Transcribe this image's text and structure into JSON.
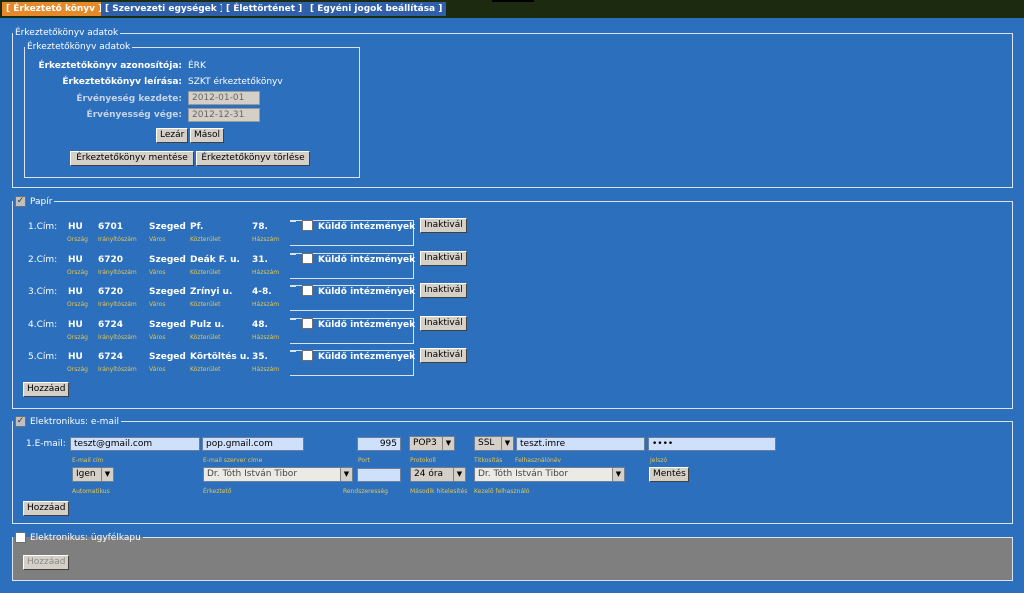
{
  "tabs": [
    "[ Érkeztető könyv ]",
    "[ Szervezeti egységek ]",
    "[ Élettörténet ]",
    "[ Egyéni jogok beállítása ]"
  ],
  "section_main": {
    "legend": "Érkeztetőkönyv adatok",
    "inner_legend": "Érkeztetőkönyv adatok",
    "id_label": "Érkeztetőkönyv azonosítója:",
    "id_value": "ÉRK",
    "desc_label": "Érkeztetőkönyv leírása:",
    "desc_value": "SZKT érkeztetőkönyv",
    "start_label": "Érvényeség kezdete:",
    "start_value": "2012-01-01",
    "end_label": "Érvényesség vége:",
    "end_value": "2012-12-31",
    "lock_button": "Lezár",
    "copy_button": "Másol",
    "save_button": "Érkeztetőkönyv mentése",
    "delete_button": "Érkeztetőkönyv törlése"
  },
  "paper": {
    "legend": "Papír",
    "checked": true,
    "sublabels": {
      "country": "Ország",
      "zip": "Irányítószám",
      "city": "Város",
      "street": "Közterület",
      "number": "Házszám"
    },
    "sender_label": "Küldő intézmények",
    "inactivate_label": "Inaktivál",
    "addresses": [
      {
        "label": "1.Cím:",
        "country": "HU",
        "zip": "6701",
        "city": "Szeged",
        "street": "Pf.",
        "number": "78."
      },
      {
        "label": "2.Cím:",
        "country": "HU",
        "zip": "6720",
        "city": "Szeged",
        "street": "Deák F. u.",
        "number": "31."
      },
      {
        "label": "3.Cím:",
        "country": "HU",
        "zip": "6720",
        "city": "Szeged",
        "street": "Zrínyi u.",
        "number": "4-8."
      },
      {
        "label": "4.Cím:",
        "country": "HU",
        "zip": "6724",
        "city": "Szeged",
        "street": "Pulz u.",
        "number": "48."
      },
      {
        "label": "5.Cím:",
        "country": "HU",
        "zip": "6724",
        "city": "Szeged",
        "street": "Körtöltés u.",
        "number": "35."
      }
    ],
    "add_button": "Hozzáad"
  },
  "email": {
    "legend": "Elektronikus: e-mail",
    "checked": true,
    "row_label": "1.E-mail:",
    "email_value": "teszt@gmail.com",
    "email_caption": "E-mail cím",
    "server_value": "pop.gmail.com",
    "server_caption": "E-mail szerver címe",
    "port_value": "995",
    "port_caption": "Port",
    "protocol_value": "POP3",
    "protocol_caption": "Protokoll",
    "encryption_value": "SSL",
    "encryption_caption": "Titkosítás",
    "username_value": "teszt.imre",
    "username_caption": "Felhasználónév",
    "password_value": "••••",
    "password_caption": "Jelszó",
    "auto_value": "Igen",
    "auto_caption": "Automatikus",
    "registrar_value": "Dr. Tóth István Tibor",
    "registrar_caption": "Érkeztető",
    "frequency_value": "",
    "frequency_caption": "Rendszeresség",
    "second_auth_value": "24 óra",
    "second_auth_caption": "Második hitelesítés",
    "handler_value": "Dr. Tóth István Tibor",
    "handler_caption": "Kezelő felhasználó",
    "save_button": "Mentés",
    "add_button": "Hozzáad"
  },
  "client_gate": {
    "legend": "Elektronikus: ügyfélkapu",
    "checked": false,
    "add_button": "Hozzáad"
  }
}
